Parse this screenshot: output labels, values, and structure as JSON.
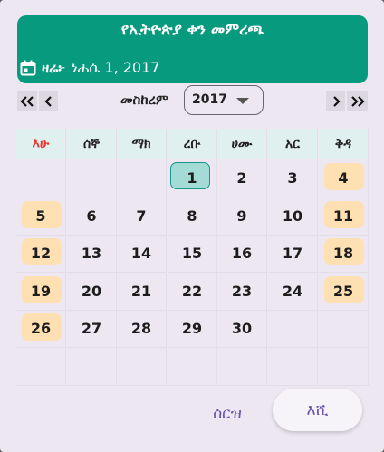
{
  "header": {
    "title": "የኢትዮጵያ ቀን መምረጫ",
    "today_label": "ዛሬ፦",
    "today_value": "ነሐሴ 1, 2017",
    "icon": "calendar-icon"
  },
  "nav": {
    "month_label": "መስከረም",
    "year_value": "2017",
    "icons": [
      "double-chevron-left-icon",
      "chevron-left-icon",
      "chevron-right-icon",
      "double-chevron-right-icon"
    ]
  },
  "weekdays": [
    "እሁ",
    "ሰኞ",
    "ማክ",
    "ረቡ",
    "ሀሙ",
    "አር",
    "ቅዳ"
  ],
  "weeks": [
    [
      "",
      "",
      "",
      "1",
      "2",
      "3",
      "4"
    ],
    [
      "5",
      "6",
      "7",
      "8",
      "9",
      "10",
      "11"
    ],
    [
      "12",
      "13",
      "14",
      "15",
      "16",
      "17",
      "18"
    ],
    [
      "19",
      "20",
      "21",
      "22",
      "23",
      "24",
      "25"
    ],
    [
      "26",
      "27",
      "28",
      "29",
      "30",
      "",
      ""
    ],
    [
      "",
      "",
      "",
      "",
      "",
      "",
      ""
    ]
  ],
  "selected_day": "1",
  "colors": {
    "header_bg": "#079a7f",
    "weekend_highlight": "#ffe0b2",
    "selected_fill": "#a5dbd6",
    "selected_border": "#17988a",
    "sunday_header_text": "#e53935",
    "button_text": "#6b52ae"
  },
  "actions": {
    "cancel_label": "ሰርዝ",
    "ok_label": "እሺ"
  }
}
